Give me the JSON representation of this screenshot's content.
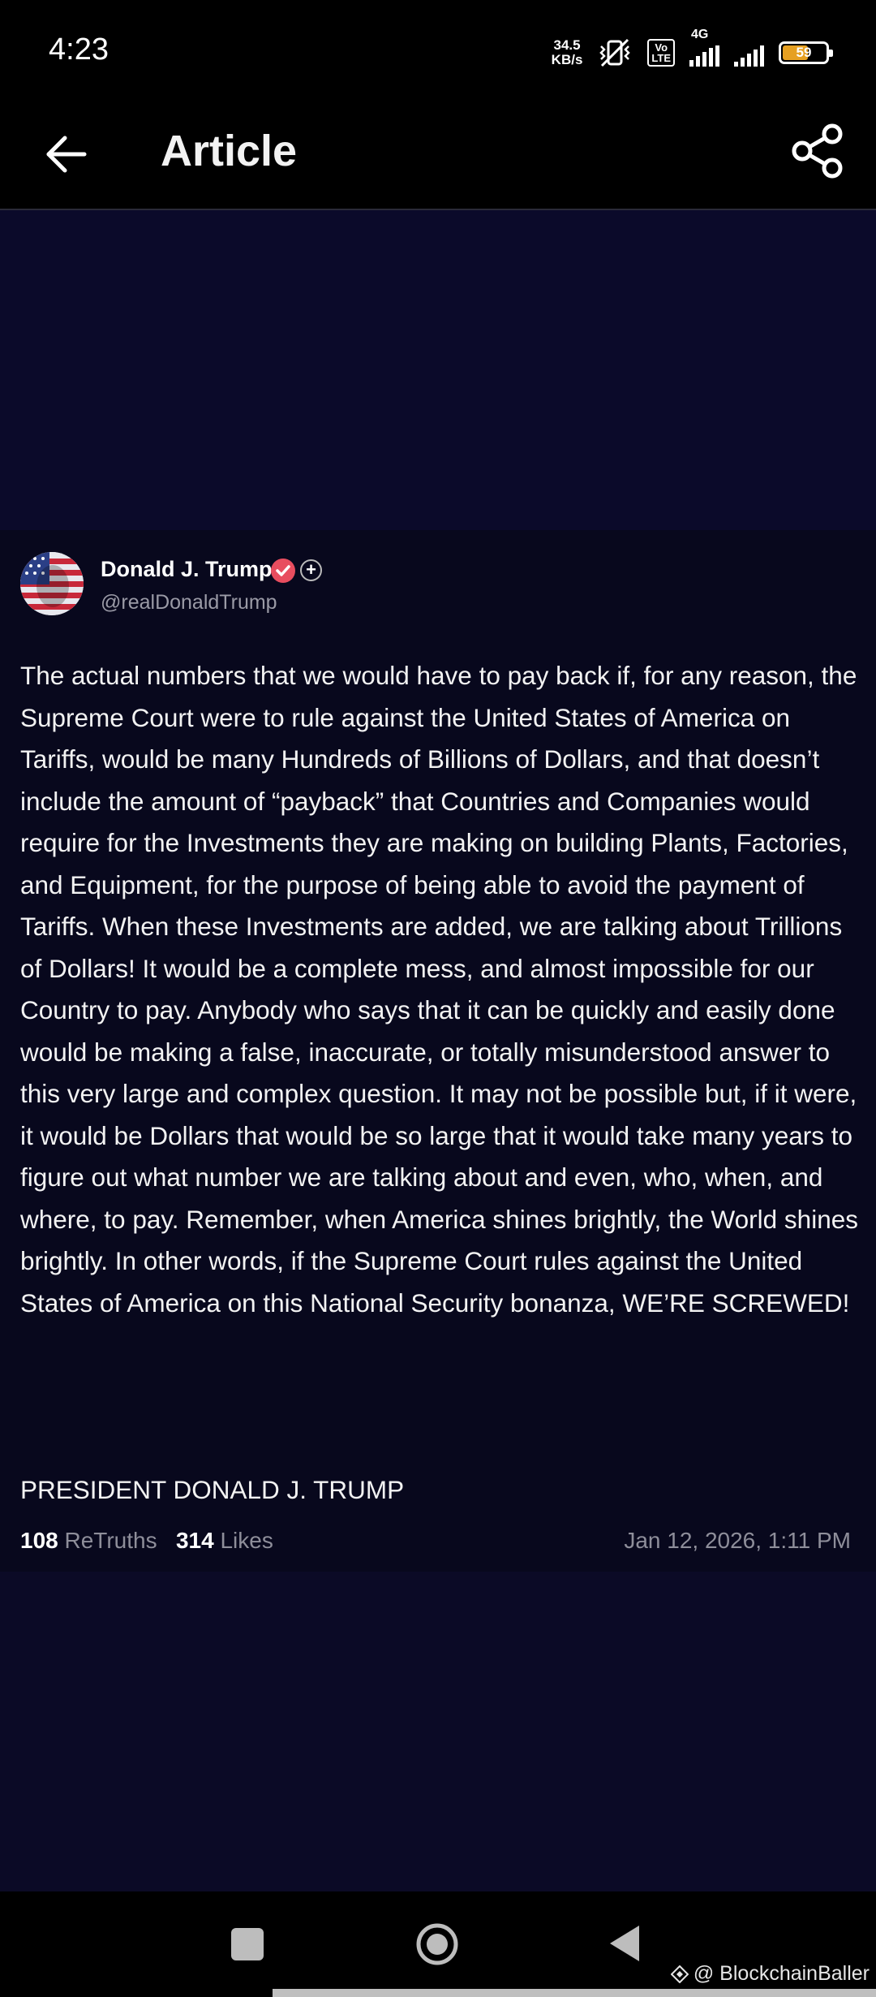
{
  "status_bar": {
    "time": "4:23",
    "net_speed_value": "34.5",
    "net_speed_unit": "KB/s",
    "volte_top": "Vo",
    "volte_bottom": "LTE",
    "network_type": "4G",
    "battery_level": "59",
    "battery_color": "#e6a021"
  },
  "header": {
    "title": "Article",
    "back_icon": "arrow-left-icon",
    "share_icon": "share-icon"
  },
  "post": {
    "author_name": "Donald J. Trump",
    "handle": "@realDonaldTrump",
    "verified_icon": "verified-check-icon",
    "body": "The actual numbers that we would have to pay back if, for any reason, the Supreme Court were to rule against the United States of America on Tariffs, would be many Hundreds of Billions of Dollars, and that doesn’t include the amount of “payback” that Countries and Companies would require for the Investments they are making on building Plants, Factories, and Equipment, for the purpose of being able to avoid the payment of Tariffs. When these Investments are added, we are talking about Trillions of Dollars! It would be a complete mess, and almost impossible for our Country to pay. Anybody who says that it can be quickly and easily done would be making a false, inaccurate, or totally misunderstood answer to this very large and complex question. It may not be possible but, if it were, it would be Dollars that would be so large that it would take many years to figure out what number we are talking about and even, who, when, and where, to pay. Remember, when America shines brightly, the World shines brightly. In other words, if the Supreme Court rules against the United States of America on this National Security bonanza, WE’RE SCREWED!",
    "signature": "PRESIDENT DONALD J. TRUMP",
    "retruths_count": "108",
    "retruths_label": "ReTruths",
    "likes_count": "314",
    "likes_label": "Likes",
    "timestamp": "Jan 12, 2026, 1:11 PM"
  },
  "nav_bar": {
    "recents_icon": "square-icon",
    "home_icon": "circle-home-icon",
    "back_icon": "triangle-back-icon"
  },
  "watermark": {
    "text": "@ BlockchainBaller"
  }
}
